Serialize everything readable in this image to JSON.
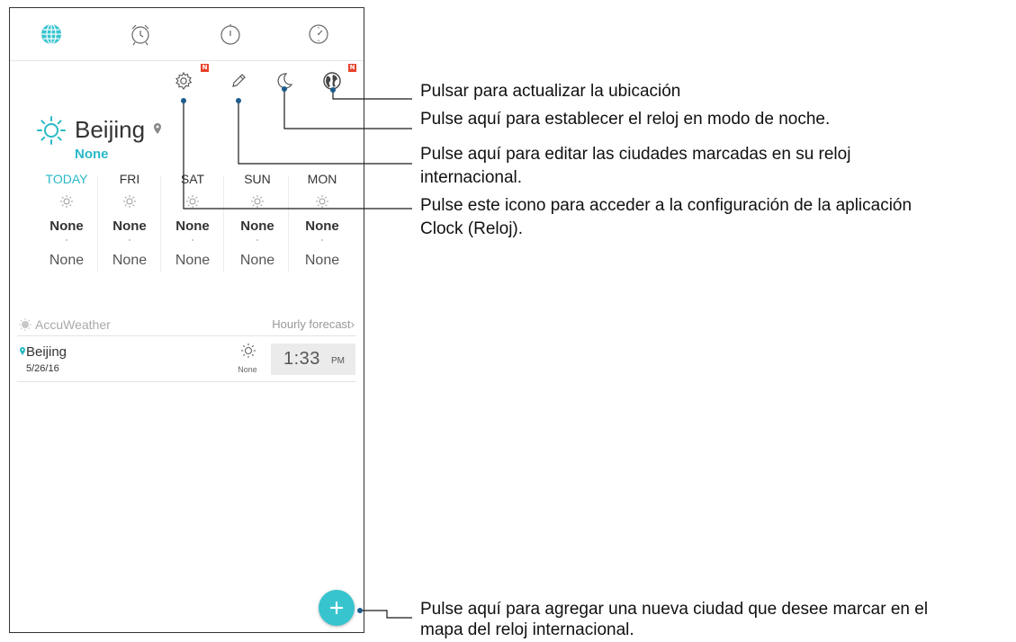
{
  "city": {
    "name": "Beijing",
    "condition": "None"
  },
  "forecast": [
    {
      "day": "TODAY",
      "high": "None",
      "low": "None",
      "today": true
    },
    {
      "day": "FRI",
      "high": "None",
      "low": "None"
    },
    {
      "day": "SAT",
      "high": "None",
      "low": "None"
    },
    {
      "day": "SUN",
      "high": "None",
      "low": "None"
    },
    {
      "day": "MON",
      "high": "None",
      "low": "None"
    }
  ],
  "provider": {
    "name": "AccuWeather",
    "hourly_label": "Hourly forecast›"
  },
  "world_list": [
    {
      "city": "Beijing",
      "date": "5/26/16",
      "condition": "None",
      "time": "1:33",
      "ampm": "PM"
    }
  ],
  "badges": {
    "settings": "N",
    "location": "N"
  },
  "annotations": {
    "location": "Pulsar para actualizar la ubicación",
    "night": "Pulse aquí para establecer el reloj en modo de noche.",
    "edit_line1": "Pulse aquí para editar las ciudades marcadas en su reloj",
    "edit_line2": "internacional.",
    "settings_line1": "Pulse este icono para acceder a la configuración de la aplicación",
    "settings_line2": "Clock (Reloj).",
    "add_line1": "Pulse aquí para agregar una nueva ciudad que desee marcar en el",
    "add_line2": "mapa del reloj internacional."
  },
  "colors": {
    "accent": "#28b9c6",
    "fab": "#37c4cf",
    "badge": "#e8422a",
    "callout_dot": "#1d5c8c"
  }
}
